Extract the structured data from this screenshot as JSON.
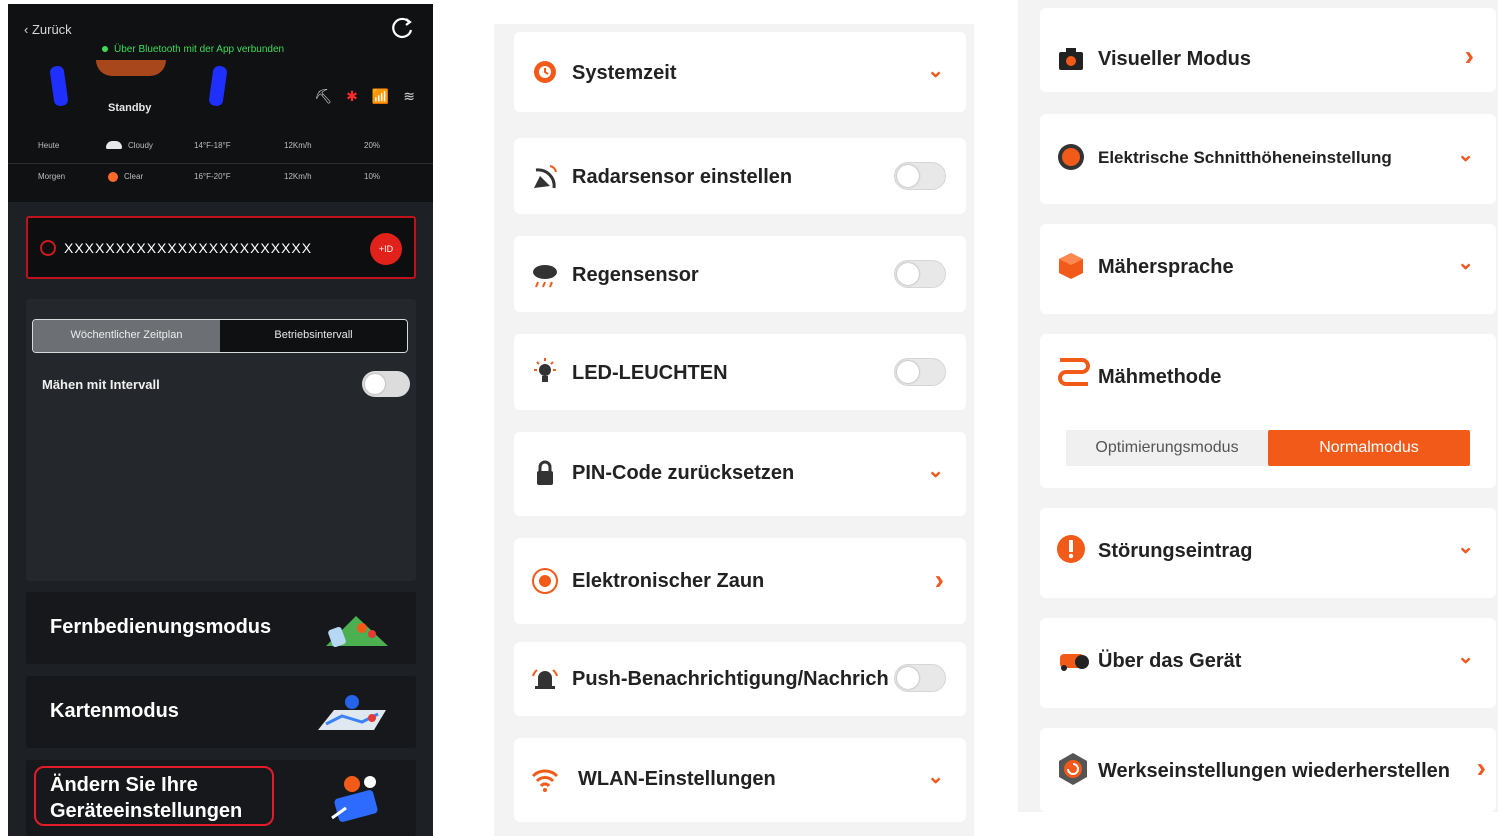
{
  "phone": {
    "back": "‹ Zurück",
    "bluetooth_msg": "Über Bluetooth mit der App verbunden",
    "status": "Standby",
    "weather": [
      {
        "day": "Heute",
        "cond": "Cloudy",
        "temp": "14°F-18°F",
        "wind": "12Km/h",
        "rain": "20%"
      },
      {
        "day": "Morgen",
        "cond": "Clear",
        "temp": "16°F-20°F",
        "wind": "12Km/h",
        "rain": "10%"
      }
    ],
    "serial": "XXXXXXXXXXXXXXXXXXXXXXXX",
    "serial_btn": "+ID",
    "tabs": {
      "weekly": "Wöchentlicher Zeitplan",
      "interval": "Betriebsintervall"
    },
    "interval_label": "Mähen mit Intervall",
    "modes": {
      "remote": "Fernbedienungsmodus",
      "map": "Kartenmodus",
      "settings_line1": "Ändern Sie Ihre",
      "settings_line2": "Geräteeinstellungen"
    }
  },
  "settings_left": [
    {
      "label": "Systemzeit",
      "control": "chevron-down"
    },
    {
      "label": "Radarsensor einstellen",
      "control": "toggle",
      "value": false
    },
    {
      "label": "Regensensor",
      "control": "toggle",
      "value": false
    },
    {
      "label": "LED-LEUCHTEN",
      "control": "toggle",
      "value": false
    },
    {
      "label": "PIN-Code zurücksetzen",
      "control": "chevron-down"
    },
    {
      "label": "Elektronischer Zaun",
      "control": "chevron-right"
    },
    {
      "label": "Push-Benachrichtigung/Nachrich",
      "control": "toggle",
      "value": false
    },
    {
      "label": "WLAN-Einstellungen",
      "control": "chevron-down"
    }
  ],
  "settings_right": [
    {
      "label": "Visueller Modus",
      "control": "chevron-right"
    },
    {
      "label": "Elektrische Schnitthöheneinstellung",
      "control": "chevron-down"
    },
    {
      "label": "Mähersprache",
      "control": "chevron-down"
    },
    {
      "label": "Mähmethode",
      "options": [
        "Optimierungsmodus",
        "Normalmodus"
      ],
      "selected": "Normalmodus"
    },
    {
      "label": "Störungseintrag",
      "control": "chevron-down"
    },
    {
      "label": "Über das Gerät",
      "control": "chevron-down"
    },
    {
      "label": "Werkseinstellungen wiederherstellen",
      "control": "chevron-right"
    }
  ],
  "colors": {
    "accent": "#f25a1a",
    "phone_bg": "#1d2024",
    "highlight": "#e51a2a"
  },
  "glyphs": {
    "chev_down": "⌄",
    "chev_right": "›"
  }
}
